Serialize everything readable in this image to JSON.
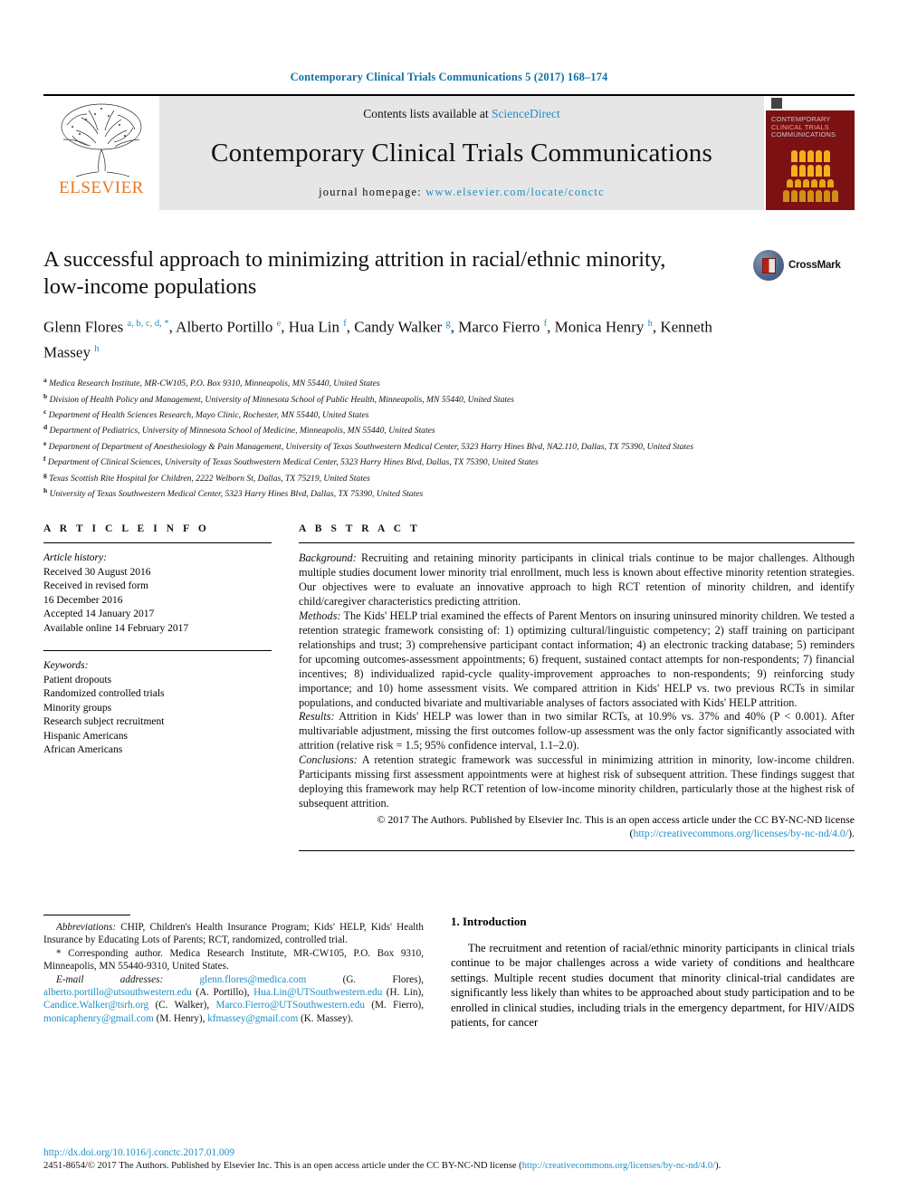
{
  "running_head": "Contemporary Clinical Trials Communications 5 (2017) 168–174",
  "masthead": {
    "publisher": "ELSEVIER",
    "contents_prefix": "Contents lists available at ",
    "contents_link": "ScienceDirect",
    "journal_title": "Contemporary Clinical Trials Communications",
    "homepage_prefix": "journal homepage: ",
    "homepage_url": "www.elsevier.com/locate/conctc",
    "cover_title_line1": "CONTEMPORARY",
    "cover_title_line2": "CLINICAL TRIALS",
    "cover_title_line3": "COMMUNICATIONS"
  },
  "crossmark": {
    "label": "CrossMark"
  },
  "article": {
    "title": "A successful approach to minimizing attrition in racial/ethnic minority, low-income populations",
    "authors_html": "Glenn Flores <sup>a, b, c, d, *</sup>, Alberto Portillo <sup>e</sup>, Hua Lin <sup>f</sup>, Candy Walker <sup>g</sup>, Marco Fierro <sup>f</sup>, Monica Henry <sup>h</sup>, Kenneth Massey <sup>h</sup>",
    "affiliations": [
      {
        "marker": "a",
        "text": "Medica Research Institute, MR-CW105, P.O. Box 9310, Minneapolis, MN 55440, United States"
      },
      {
        "marker": "b",
        "text": "Division of Health Policy and Management, University of Minnesota School of Public Health, Minneapolis, MN 55440, United States"
      },
      {
        "marker": "c",
        "text": "Department of Health Sciences Research, Mayo Clinic, Rochester, MN 55440, United States"
      },
      {
        "marker": "d",
        "text": "Department of Pediatrics, University of Minnesota School of Medicine, Minneapolis, MN 55440, United States"
      },
      {
        "marker": "e",
        "text": "Department of Department of Anesthesiology & Pain Management, University of Texas Southwestern Medical Center, 5323 Harry Hines Blvd, NA2.110, Dallas, TX 75390, United States"
      },
      {
        "marker": "f",
        "text": "Department of Clinical Sciences, University of Texas Southwestern Medical Center, 5323 Harry Hines Blvd, Dallas, TX 75390, United States"
      },
      {
        "marker": "g",
        "text": "Texas Scottish Rite Hospital for Children, 2222 Welborn St, Dallas, TX 75219, United States"
      },
      {
        "marker": "h",
        "text": "University of Texas Southwestern Medical Center, 5323 Harry Hines Blvd, Dallas, TX 75390, United States"
      }
    ]
  },
  "article_info": {
    "heading": "A R T I C L E  I N F O",
    "history_label": "Article history:",
    "history": [
      "Received 30 August 2016",
      "Received in revised form",
      "16 December 2016",
      "Accepted 14 January 2017",
      "Available online 14 February 2017"
    ],
    "keywords_label": "Keywords:",
    "keywords": [
      "Patient dropouts",
      "Randomized controlled trials",
      "Minority groups",
      "Research subject recruitment",
      "Hispanic Americans",
      "African Americans"
    ]
  },
  "abstract": {
    "heading": "A B S T R A C T",
    "sections": [
      {
        "label": "Background:",
        "text": " Recruiting and retaining minority participants in clinical trials continue to be major challenges. Although multiple studies document lower minority trial enrollment, much less is known about effective minority retention strategies. Our objectives were to evaluate an innovative approach to high RCT retention of minority children, and identify child/caregiver characteristics predicting attrition."
      },
      {
        "label": "Methods:",
        "text": " The Kids' HELP trial examined the effects of Parent Mentors on insuring uninsured minority children. We tested a retention strategic framework consisting of: 1) optimizing cultural/linguistic competency; 2) staff training on participant relationships and trust; 3) comprehensive participant contact information; 4) an electronic tracking database; 5) reminders for upcoming outcomes-assessment appointments; 6) frequent, sustained contact attempts for non-respondents; 7) financial incentives; 8) individualized rapid-cycle quality-improvement approaches to non-respondents; 9) reinforcing study importance; and 10) home assessment visits. We compared attrition in Kids' HELP vs. two previous RCTs in similar populations, and conducted bivariate and multivariable analyses of factors associated with Kids' HELP attrition."
      },
      {
        "label": "Results:",
        "text": " Attrition in Kids' HELP was lower than in two similar RCTs, at 10.9% vs. 37% and 40% (P < 0.001). After multivariable adjustment, missing the first outcomes follow-up assessment was the only factor significantly associated with attrition (relative risk = 1.5; 95% confidence interval, 1.1–2.0)."
      },
      {
        "label": "Conclusions:",
        "text": " A retention strategic framework was successful in minimizing attrition in minority, low-income children. Participants missing first assessment appointments were at highest risk of subsequent attrition. These findings suggest that deploying this framework may help RCT retention of low-income minority children, particularly those at the highest risk of subsequent attrition."
      }
    ],
    "copyright_prefix": "© 2017 The Authors. Published by Elsevier Inc. This is an open access article under the CC BY-NC-ND license (",
    "copyright_link": "http://creativecommons.org/licenses/by-nc-nd/4.0/",
    "copyright_suffix": ")."
  },
  "footnotes": {
    "abbreviations_label": "Abbreviations:",
    "abbreviations_text": " CHIP, Children's Health Insurance Program; Kids' HELP, Kids' Health Insurance by Educating Lots of Parents; RCT, randomized, controlled trial.",
    "corresponding_marker": "*",
    "corresponding_text": " Corresponding author. Medica Research Institute, MR-CW105, P.O. Box 9310, Minneapolis, MN 55440-9310, United States.",
    "email_label": "E-mail addresses:",
    "emails": [
      {
        "address": "glenn.flores@medica.com",
        "owner": "(G. Flores),"
      },
      {
        "address": "alberto.portillo@utsouthwestern.edu",
        "owner": "(A. Portillo),"
      },
      {
        "address": "Hua.Lin@UTSouthwestern.edu",
        "owner": "(H. Lin),"
      },
      {
        "address": "Candice.Walker@tsrh.org",
        "owner": "(C. Walker),"
      },
      {
        "address": "Marco.Fierro@UTSouthwestern.edu",
        "owner": "(M. Fierro),"
      },
      {
        "address": "monicaphenry@gmail.com",
        "owner": "(M. Henry),"
      },
      {
        "address": "kfmassey@gmail.com",
        "owner": "(K. Massey)."
      }
    ]
  },
  "introduction": {
    "heading": "1. Introduction",
    "paragraph": "The recruitment and retention of racial/ethnic minority participants in clinical trials continue to be major challenges across a wide variety of conditions and healthcare settings. Multiple recent studies document that minority clinical-trial candidates are significantly less likely than whites to be approached about study participation and to be enrolled in clinical studies, including trials in the emergency department, for HIV/AIDS patients, for cancer"
  },
  "page_footer": {
    "doi": "http://dx.doi.org/10.1016/j.conctc.2017.01.009",
    "issn_line_prefix": "2451-8654/© 2017 The Authors. Published by Elsevier Inc. This is an open access article under the CC BY-NC-ND license (",
    "issn_link": "http://creativecommons.org/licenses/by-nc-nd/4.0/",
    "issn_line_suffix": ")."
  },
  "colors": {
    "link": "#1e8fc6",
    "running_head": "#1071a6",
    "elsevier_orange": "#e87722",
    "cover_red": "#7b1113"
  }
}
